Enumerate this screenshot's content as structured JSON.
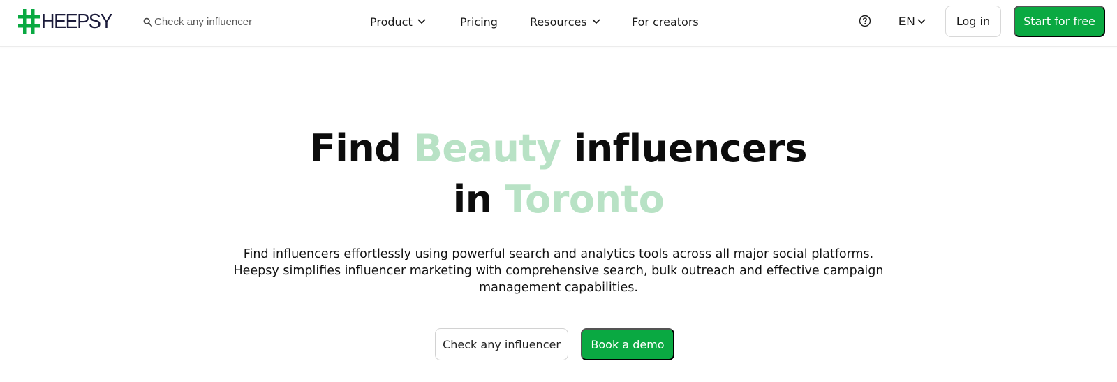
{
  "brand": {
    "logo_text": "HEEPSY",
    "logo_color": "#0aa942",
    "text_color": "#1b1b3a"
  },
  "header": {
    "search": {
      "placeholder": "Check any influencer",
      "value": "",
      "icon": "search-icon"
    },
    "nav": {
      "product": "Product",
      "pricing": "Pricing",
      "resources": "Resources",
      "creators": "For creators"
    },
    "help_icon": "question-circle-icon",
    "language": "EN",
    "login_label": "Log in",
    "start_label": "Start for free"
  },
  "hero": {
    "title_part1": "Find ",
    "title_accent1": "Beauty",
    "title_part2": " influencers",
    "title_part3": "in ",
    "title_accent2": "Toronto",
    "subtitle": "Find influencers effortlessly using powerful search and analytics tools across all major social platforms. Heepsy simplifies influencer marketing with comprehensive search, bulk outreach and effective campaign management capabilities.",
    "check_label": "Check any influencer",
    "demo_label": "Book a demo"
  },
  "colors": {
    "primary_green": "#0aa942",
    "accent_green_light": "#b8e2c5"
  }
}
